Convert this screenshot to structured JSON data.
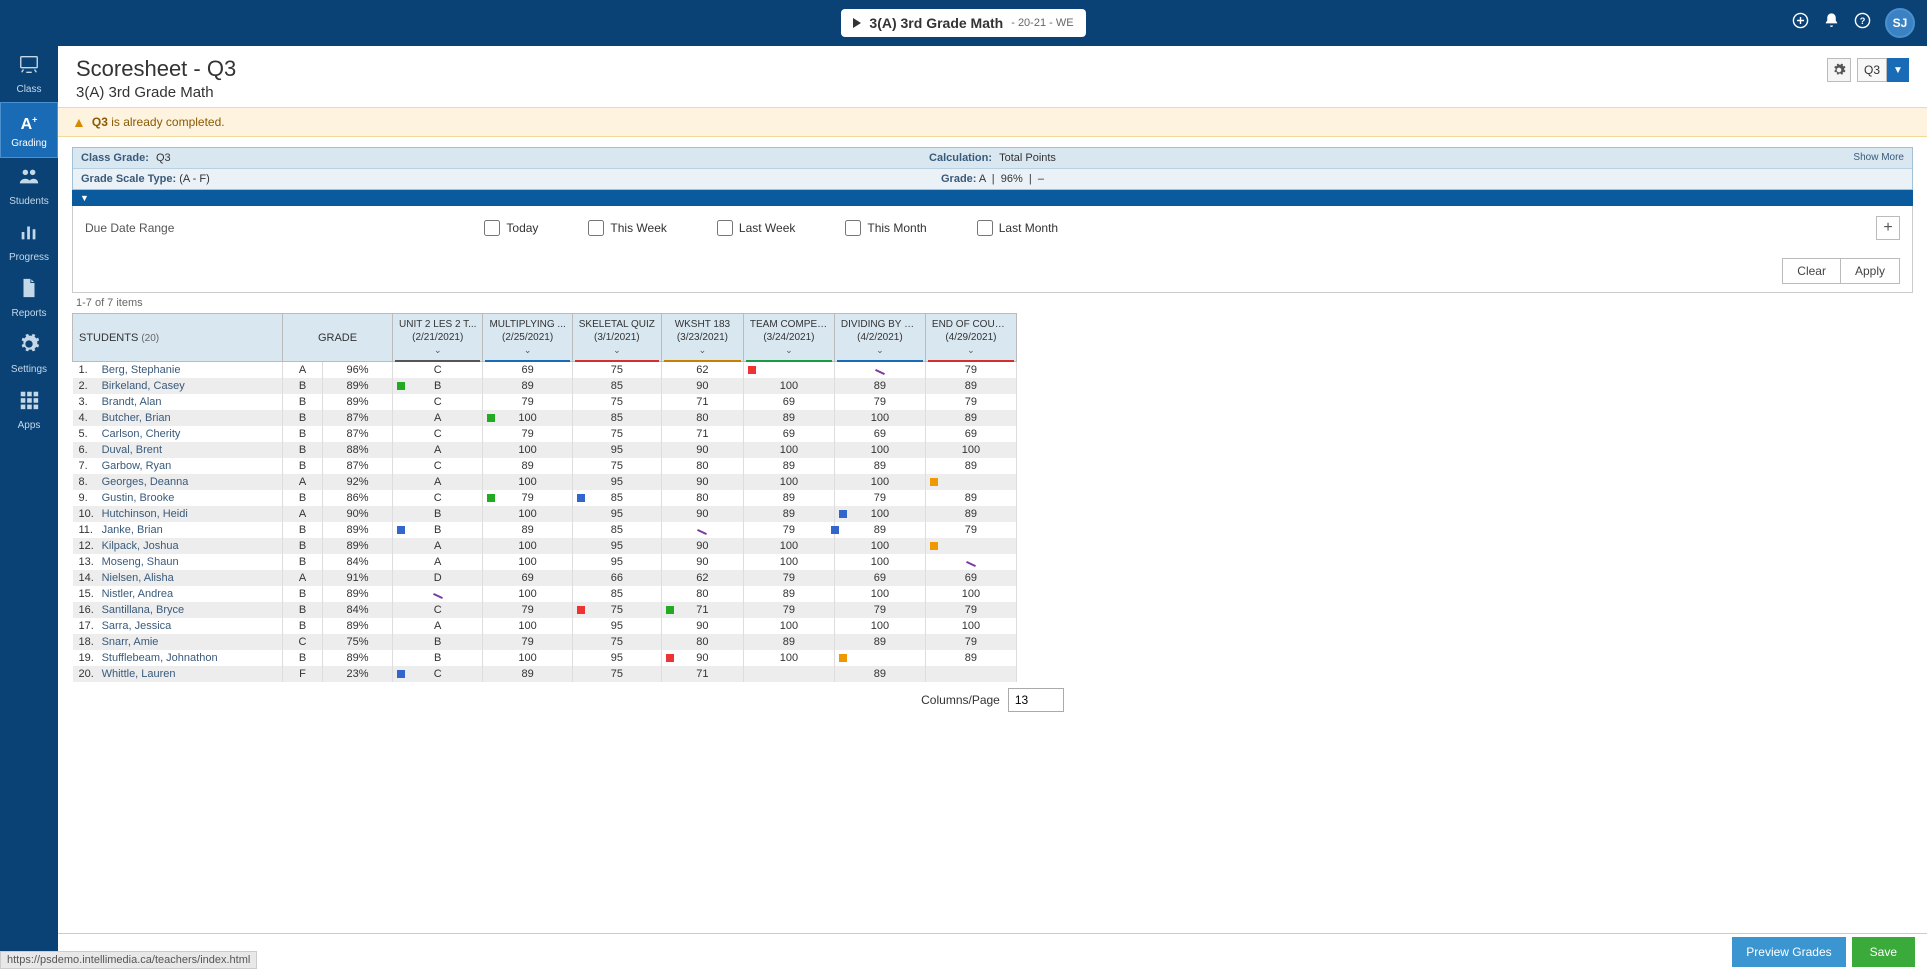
{
  "topbar": {
    "class_name": "3(A) 3rd Grade Math",
    "class_suffix": "- 20-21 - WE",
    "avatar_initials": "SJ"
  },
  "sidebar": {
    "items": [
      {
        "name": "class",
        "label": "Class",
        "icon": "chalkboard"
      },
      {
        "name": "grading",
        "label": "Grading",
        "icon": "a-plus",
        "active": true
      },
      {
        "name": "students",
        "label": "Students",
        "icon": "people"
      },
      {
        "name": "progress",
        "label": "Progress",
        "icon": "bar-chart"
      },
      {
        "name": "reports",
        "label": "Reports",
        "icon": "file"
      },
      {
        "name": "settings",
        "label": "Settings",
        "icon": "gear"
      },
      {
        "name": "apps",
        "label": "Apps",
        "icon": "grid"
      }
    ]
  },
  "page": {
    "title": "Scoresheet - Q3",
    "subtitle": "3(A) 3rd Grade Math",
    "term_label": "Q3"
  },
  "warning": {
    "prefix": "Q3",
    "text": " is already completed."
  },
  "summary": {
    "class_grade_label": "Class Grade:",
    "class_grade": "Q3",
    "calc_label": "Calculation:",
    "calc_val": "Total Points",
    "show_more": "Show More",
    "scale_label": "Grade Scale Type:",
    "scale_val": "(A - F)",
    "grade_label": "Grade:",
    "grade_letter": "A",
    "grade_pct": "96%",
    "grade_dash": "–"
  },
  "filter": {
    "label": "Due Date Range",
    "options": [
      "Today",
      "This Week",
      "Last Week",
      "This Month",
      "Last Month"
    ],
    "clear_label": "Clear",
    "apply_label": "Apply"
  },
  "pagination": "1-7 of 7 items",
  "table": {
    "students_header": "STUDENTS",
    "student_count": "(20)",
    "grade_header": "GRADE",
    "assignments": [
      {
        "name": "UNIT 2 LES 2 T...",
        "date": "(2/21/2021)",
        "color": "#555"
      },
      {
        "name": "MULTIPLYING ...",
        "date": "(2/25/2021)",
        "color": "#1a6bb5"
      },
      {
        "name": "SKELETAL QUIZ",
        "date": "(3/1/2021)",
        "color": "#d03030"
      },
      {
        "name": "WKSHT 183",
        "date": "(3/23/2021)",
        "color": "#c88000"
      },
      {
        "name": "TEAM COMPET...",
        "date": "(3/24/2021)",
        "color": "#1a9a45"
      },
      {
        "name": "DIVIDING BY 1-...",
        "date": "(4/2/2021)",
        "color": "#1a6bb5"
      },
      {
        "name": "END OF COUR...",
        "date": "(4/29/2021)",
        "color": "#d03030"
      }
    ],
    "rows": [
      {
        "n": 1,
        "name": "Berg, Stephanie",
        "letter": "A",
        "pct": "96%",
        "scores": [
          "C",
          "69",
          "75",
          "62",
          "",
          "",
          ""
        ],
        "flags": [
          null,
          null,
          null,
          null,
          "red",
          "mark",
          null
        ],
        "score_override": {
          "6": "79"
        }
      },
      {
        "n": 2,
        "name": "Birkeland, Casey",
        "letter": "B",
        "pct": "89%",
        "scores": [
          "B",
          "89",
          "85",
          "90",
          "100",
          "89",
          "89"
        ],
        "flags": [
          "green",
          null,
          null,
          null,
          null,
          null,
          null
        ]
      },
      {
        "n": 3,
        "name": "Brandt, Alan",
        "letter": "B",
        "pct": "89%",
        "scores": [
          "C",
          "79",
          "75",
          "71",
          "69",
          "79",
          "79"
        ],
        "flags": [
          null,
          null,
          null,
          null,
          null,
          null,
          null
        ]
      },
      {
        "n": 4,
        "name": "Butcher, Brian",
        "letter": "B",
        "pct": "87%",
        "scores": [
          "A",
          "100",
          "85",
          "80",
          "89",
          "100",
          "89"
        ],
        "flags": [
          null,
          "green",
          null,
          null,
          null,
          null,
          null
        ]
      },
      {
        "n": 5,
        "name": "Carlson, Cherity",
        "letter": "B",
        "pct": "87%",
        "scores": [
          "C",
          "79",
          "75",
          "71",
          "69",
          "69",
          "69"
        ],
        "flags": [
          null,
          null,
          null,
          null,
          null,
          null,
          null
        ]
      },
      {
        "n": 6,
        "name": "Duval, Brent",
        "letter": "B",
        "pct": "88%",
        "scores": [
          "A",
          "100",
          "95",
          "90",
          "100",
          "100",
          "100"
        ],
        "flags": [
          null,
          null,
          null,
          null,
          null,
          null,
          null
        ]
      },
      {
        "n": 7,
        "name": "Garbow, Ryan",
        "letter": "B",
        "pct": "87%",
        "scores": [
          "C",
          "89",
          "75",
          "80",
          "89",
          "89",
          "89"
        ],
        "flags": [
          null,
          null,
          null,
          null,
          null,
          null,
          null
        ]
      },
      {
        "n": 8,
        "name": "Georges, Deanna",
        "letter": "A",
        "pct": "92%",
        "scores": [
          "A",
          "100",
          "95",
          "90",
          "100",
          "100",
          ""
        ],
        "flags": [
          null,
          null,
          null,
          null,
          null,
          null,
          "orange"
        ]
      },
      {
        "n": 9,
        "name": "Gustin, Brooke",
        "letter": "B",
        "pct": "86%",
        "scores": [
          "C",
          "79",
          "85",
          "80",
          "89",
          "79",
          "89"
        ],
        "flags": [
          null,
          "green",
          "blue",
          null,
          null,
          null,
          null
        ]
      },
      {
        "n": 10,
        "name": "Hutchinson, Heidi",
        "letter": "A",
        "pct": "90%",
        "scores": [
          "B",
          "100",
          "95",
          "90",
          "89",
          "100",
          "89"
        ],
        "flags": [
          null,
          null,
          null,
          null,
          null,
          "blue",
          null
        ]
      },
      {
        "n": 11,
        "name": "Janke, Brian",
        "letter": "B",
        "pct": "89%",
        "scores": [
          "B",
          "89",
          "85",
          "",
          "79",
          "89",
          "79"
        ],
        "flags": [
          "blue",
          null,
          null,
          "mark",
          null,
          null,
          null
        ],
        "leftflag": {
          "5": "blue"
        }
      },
      {
        "n": 12,
        "name": "Kilpack, Joshua",
        "letter": "B",
        "pct": "89%",
        "scores": [
          "A",
          "100",
          "95",
          "90",
          "100",
          "100",
          ""
        ],
        "flags": [
          null,
          null,
          null,
          null,
          null,
          null,
          "orange"
        ]
      },
      {
        "n": 13,
        "name": "Moseng, Shaun",
        "letter": "B",
        "pct": "84%",
        "scores": [
          "A",
          "100",
          "95",
          "90",
          "100",
          "100",
          ""
        ],
        "flags": [
          null,
          null,
          null,
          null,
          null,
          null,
          "mark"
        ]
      },
      {
        "n": 14,
        "name": "Nielsen, Alisha",
        "letter": "A",
        "pct": "91%",
        "scores": [
          "D",
          "69",
          "66",
          "62",
          "79",
          "69",
          "69"
        ],
        "flags": [
          null,
          null,
          null,
          null,
          null,
          null,
          null
        ]
      },
      {
        "n": 15,
        "name": "Nistler, Andrea",
        "letter": "B",
        "pct": "89%",
        "scores": [
          "",
          "100",
          "85",
          "80",
          "89",
          "100",
          "100"
        ],
        "flags": [
          "mark",
          null,
          null,
          null,
          null,
          null,
          null
        ]
      },
      {
        "n": 16,
        "name": "Santillana, Bryce",
        "letter": "B",
        "pct": "84%",
        "scores": [
          "C",
          "79",
          "75",
          "71",
          "79",
          "79",
          "79"
        ],
        "flags": [
          null,
          null,
          "red",
          "green",
          null,
          null,
          null
        ]
      },
      {
        "n": 17,
        "name": "Sarra, Jessica",
        "letter": "B",
        "pct": "89%",
        "scores": [
          "A",
          "100",
          "95",
          "90",
          "100",
          "100",
          "100"
        ],
        "flags": [
          null,
          null,
          null,
          null,
          null,
          null,
          null
        ]
      },
      {
        "n": 18,
        "name": "Snarr, Amie",
        "letter": "C",
        "pct": "75%",
        "scores": [
          "B",
          "79",
          "75",
          "80",
          "89",
          "89",
          "79"
        ],
        "flags": [
          null,
          null,
          null,
          null,
          null,
          null,
          null
        ]
      },
      {
        "n": 19,
        "name": "Stufflebeam, Johnathon",
        "letter": "B",
        "pct": "89%",
        "scores": [
          "B",
          "100",
          "95",
          "90",
          "100",
          "",
          "89"
        ],
        "flags": [
          null,
          null,
          null,
          "red",
          null,
          "orange",
          null
        ]
      },
      {
        "n": 20,
        "name": "Whittle, Lauren",
        "letter": "F",
        "pct": "23%",
        "scores": [
          "C",
          "89",
          "75",
          "71",
          "",
          "89",
          ""
        ],
        "flags": [
          "blue",
          null,
          null,
          null,
          null,
          null,
          null
        ]
      }
    ]
  },
  "cols_per_page": {
    "label": "Columns/Page",
    "value": "13"
  },
  "footer": {
    "preview": "Preview Grades",
    "save": "Save"
  },
  "status_url": "https://psdemo.intellimedia.ca/teachers/index.html"
}
